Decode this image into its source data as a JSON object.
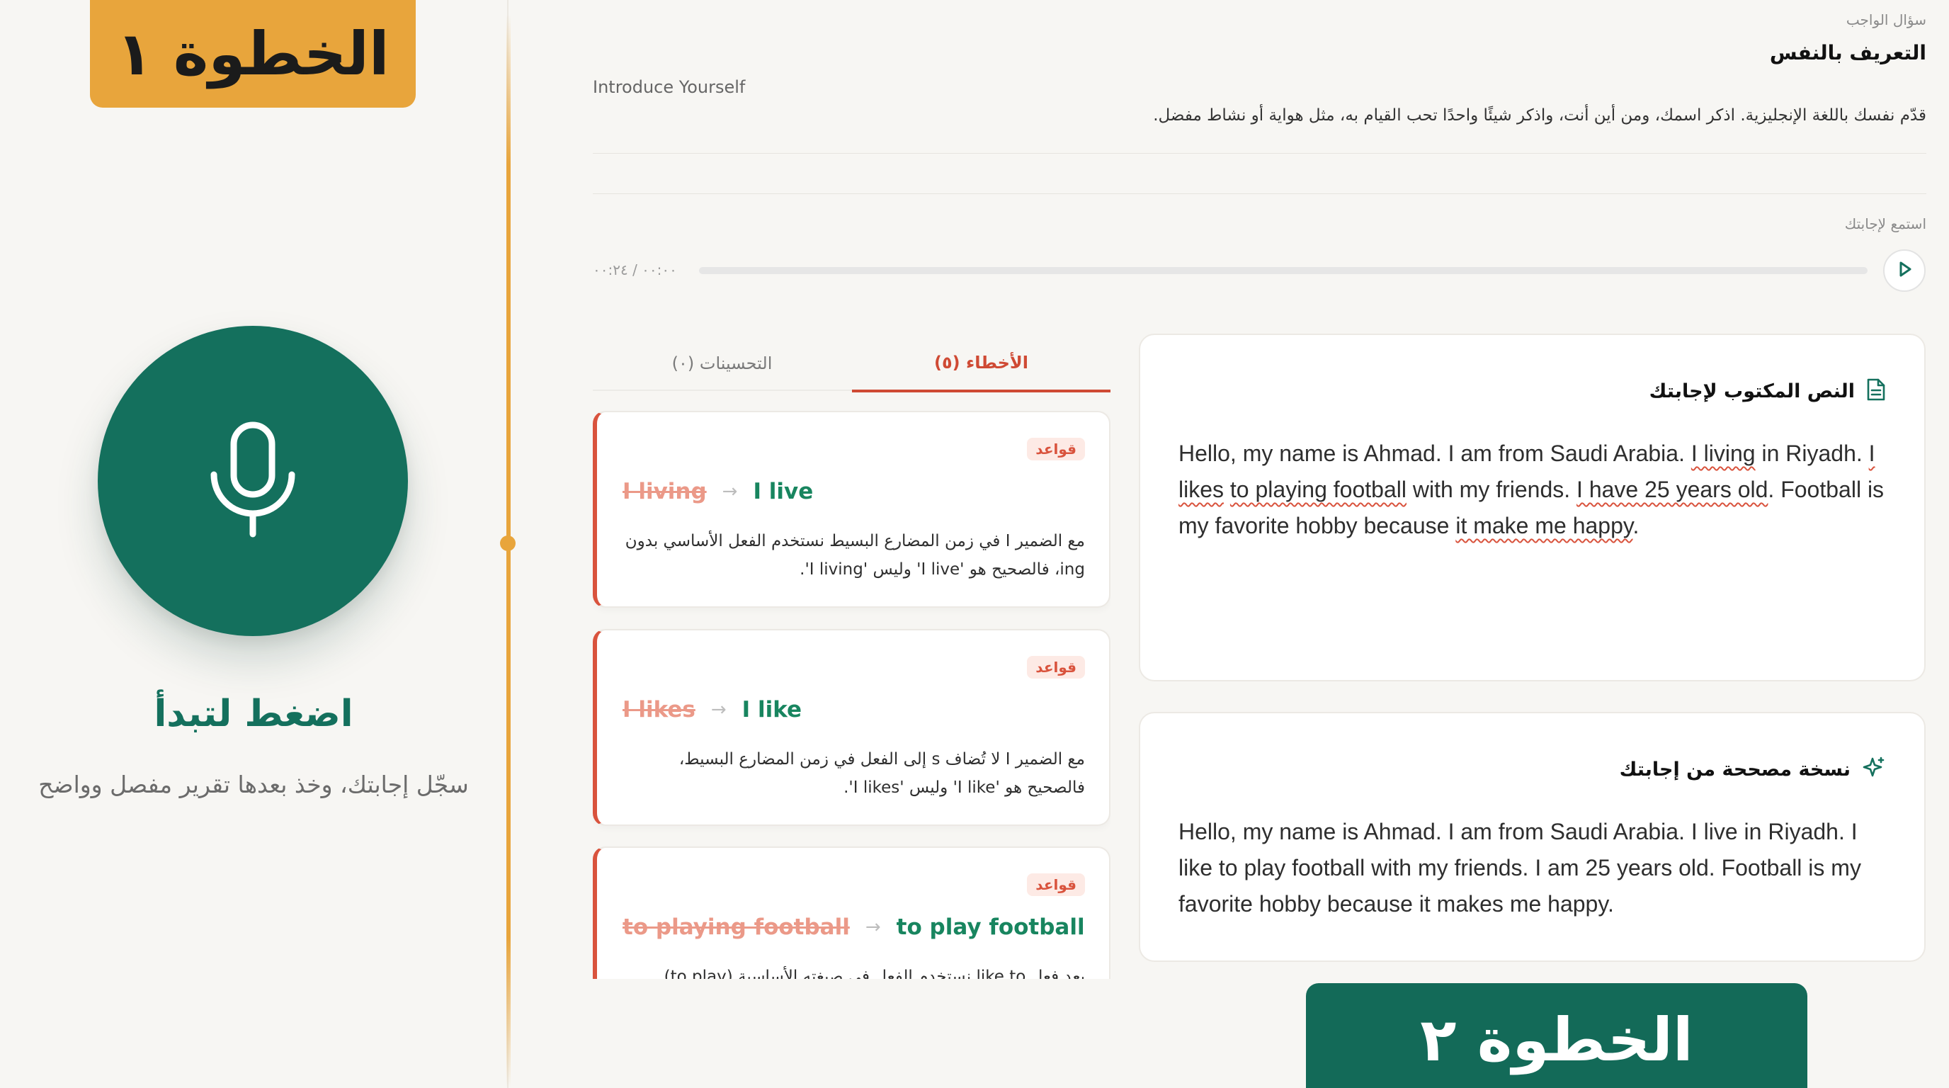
{
  "step1": {
    "badge": "الخطوة ١"
  },
  "record": {
    "title": "اضغط لتبدأ",
    "subtitle": "سجّل إجابتك، وخذ بعدها تقرير مفصل وواضح"
  },
  "question": {
    "label": "سؤال الواجب",
    "title": "التعريف بالنفس",
    "english_title": "Introduce Yourself",
    "description": "قدّم نفسك باللغة الإنجليزية. اذكر اسمك، ومن أين أنت، واذكر شيئًا واحدًا تحب القيام به، مثل هواية أو نشاط مفضل."
  },
  "audio": {
    "label": "استمع لإجابتك",
    "time": "٠٠:٠٠ / ٠٠:٢٤",
    "progress_percent": 0
  },
  "tabs": {
    "mistakes": "الأخطاء (٥)",
    "improvements": "التحسينات (٠)",
    "active": "mistakes"
  },
  "errors": [
    {
      "tag": "قواعد",
      "wrong": "I living",
      "correct": "I live",
      "explanation": "مع الضمير I في زمن المضارع البسيط نستخدم الفعل الأساسي بدون ing، فالصحيح هو 'I live' وليس 'I living'."
    },
    {
      "tag": "قواعد",
      "wrong": "I likes",
      "correct": "I like",
      "explanation": "مع الضمير I لا تُضاف s إلى الفعل في زمن المضارع البسيط، فالصحيح هو 'I like' وليس 'I likes'."
    },
    {
      "tag": "قواعد",
      "wrong": "to playing football",
      "correct": "to play football",
      "explanation": "بعد فعل like to نستخدم الفعل في صيغته الأساسية (to play) وليس"
    }
  ],
  "transcript": {
    "title": "النص المكتوب لإجابتك",
    "segments": [
      {
        "text": "Hello, my name is Ahmad. I am from Saudi Arabia. ",
        "error": false
      },
      {
        "text": "I living",
        "error": true
      },
      {
        "text": " in Riyadh. ",
        "error": false
      },
      {
        "text": "I likes",
        "error": true
      },
      {
        "text": " ",
        "error": false
      },
      {
        "text": "to playing football",
        "error": true
      },
      {
        "text": " with my friends. ",
        "error": false
      },
      {
        "text": "I have 25 years old",
        "error": true
      },
      {
        "text": ". Football is my favorite hobby because ",
        "error": false
      },
      {
        "text": "it make me happy",
        "error": true
      },
      {
        "text": ".",
        "error": false
      }
    ]
  },
  "corrected": {
    "title": "نسخة مصححة من إجابتك",
    "text": "Hello, my name is Ahmad. I am from Saudi Arabia. I live in Riyadh. I like to play football with my friends. I am 25 years old. Football is my favorite hobby because it makes me happy."
  },
  "step2": {
    "badge": "الخطوة ٢"
  },
  "colors": {
    "brand_green": "#14705d",
    "accent_orange": "#e8a53c",
    "error_red": "#d9533d",
    "correct_green": "#18855f"
  },
  "icons": {
    "mic": "microphone-icon",
    "play": "play-icon",
    "transcript": "document-icon",
    "corrected": "sparkle-icon"
  }
}
